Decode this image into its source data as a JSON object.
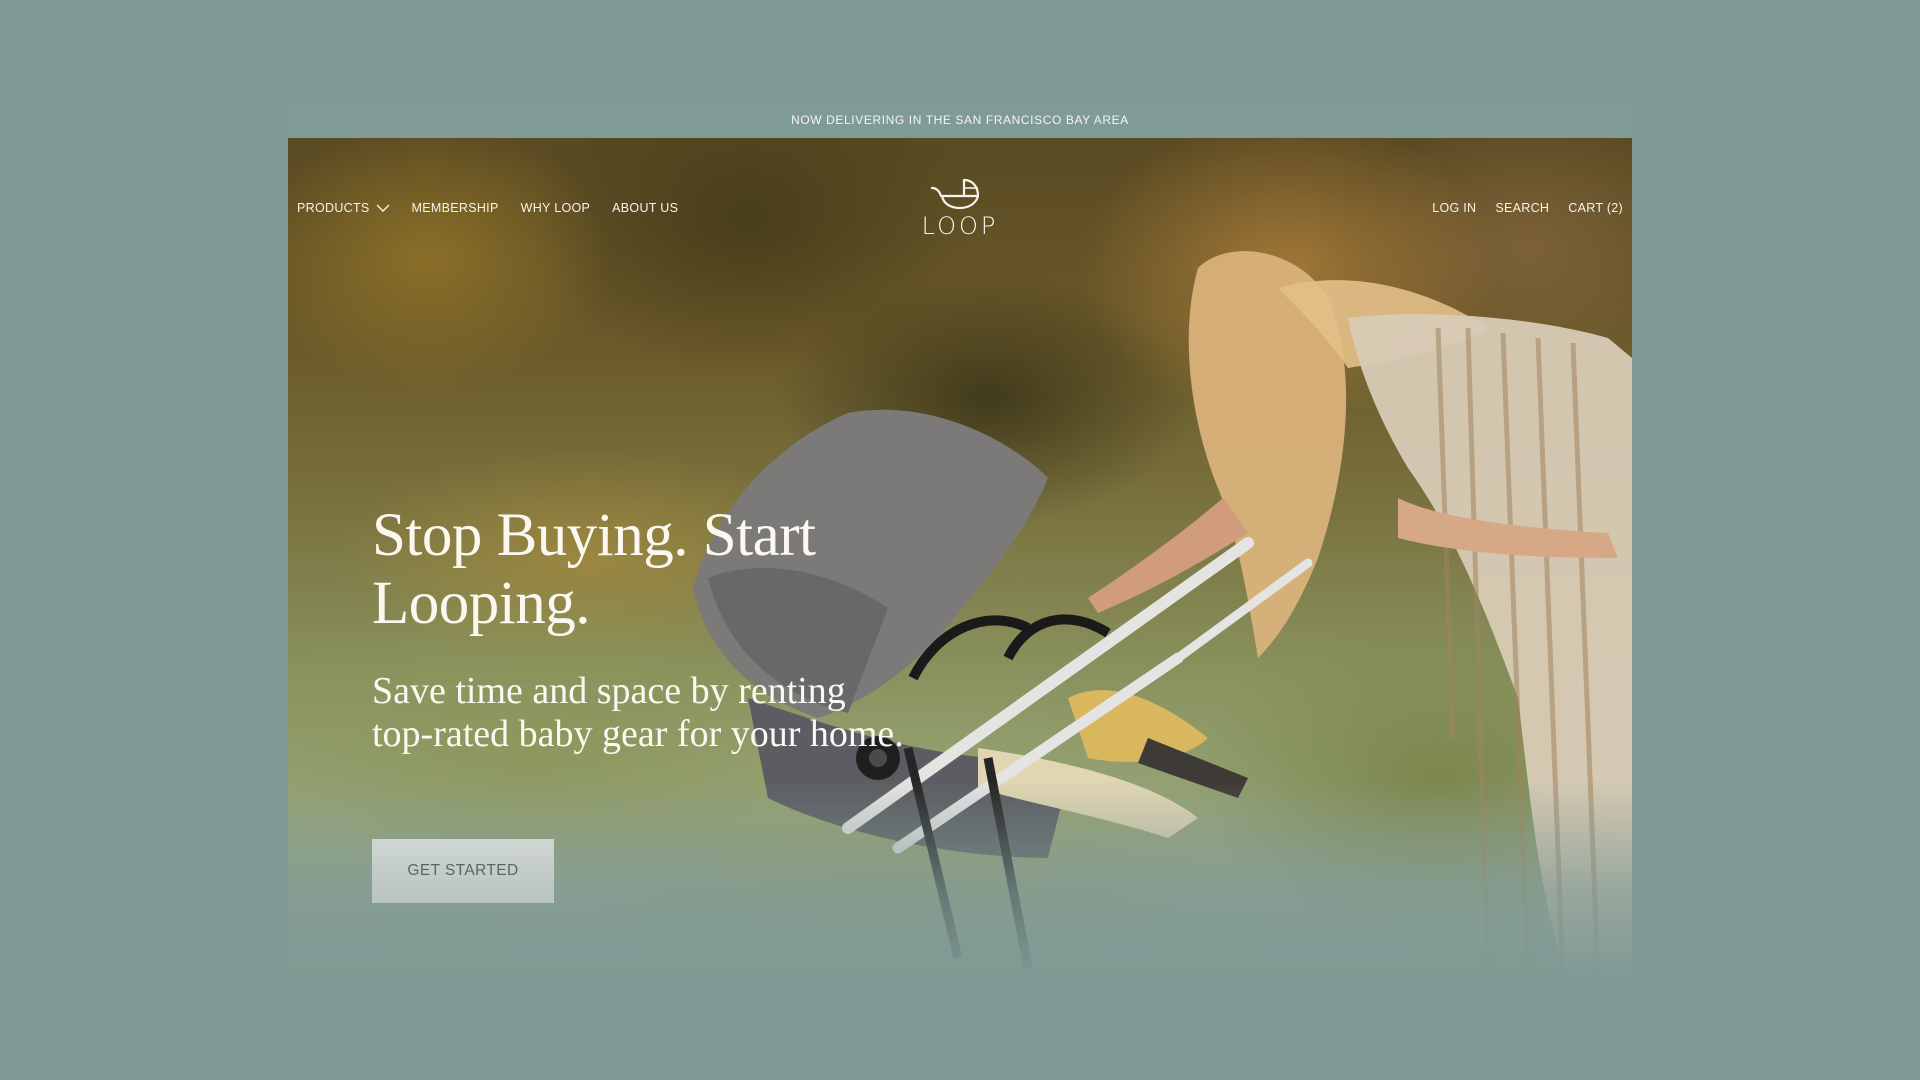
{
  "announcement": "NOW DELIVERING IN THE SAN FRANCISCO BAY AREA",
  "nav": {
    "left": [
      {
        "label": "PRODUCTS",
        "has_dropdown": true
      },
      {
        "label": "MEMBERSHIP"
      },
      {
        "label": "WHY LOOP"
      },
      {
        "label": "ABOUT US"
      }
    ],
    "right": [
      {
        "label": "LOG IN"
      },
      {
        "label": "SEARCH"
      },
      {
        "label": "CART (2)"
      }
    ]
  },
  "logo": {
    "text": "LOOP",
    "icon": "baby-carriage-icon"
  },
  "hero": {
    "headline": "Stop Buying. Start Looping.",
    "subhead": "Save time and space by renting top-rated baby gear for your home.",
    "cta": "GET STARTED",
    "image": "mother-with-stroller-photo"
  },
  "colors": {
    "page_background": "#7f9994",
    "text_light": "#fbf8f1",
    "cta_background": "#c4ccc9",
    "cta_text": "#5c6462"
  }
}
